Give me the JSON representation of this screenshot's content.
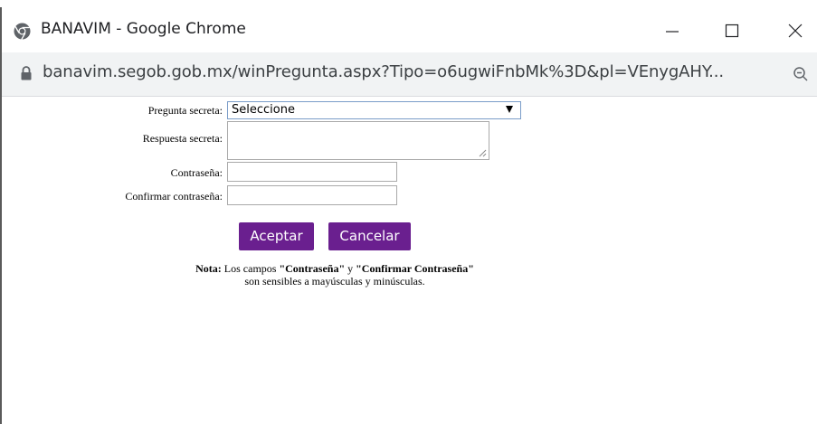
{
  "window": {
    "title": "BANAVIM - Google Chrome",
    "minimize_icon": "minimize-icon",
    "maximize_icon": "maximize-icon",
    "close_icon": "close-icon"
  },
  "addressbar": {
    "url": "banavim.segob.gob.mx/winPregunta.aspx?Tipo=o6ugwiFnbMk%3D&pl=VEnygAHY...",
    "lock_icon": "lock-icon",
    "zoom_icon": "zoom-icon"
  },
  "form": {
    "secret_question_label": "Pregunta secreta:",
    "secret_question_value": "Seleccione",
    "secret_answer_label": "Respuesta secreta:",
    "secret_answer_value": "",
    "password_label": "Contraseña:",
    "password_value": "",
    "confirm_password_label": "Confirmar contraseña:",
    "confirm_password_value": ""
  },
  "buttons": {
    "accept_label": "Aceptar",
    "cancel_label": "Cancelar",
    "color": "#6a1f8f"
  },
  "note": {
    "prefix": "Nota:",
    "text1": " Los campos ",
    "field1": "\"Contraseña\"",
    "text2": " y ",
    "field2": "\"Confirmar Contraseña\"",
    "line2": "son sensibles a mayúsculas y minúsculas."
  }
}
